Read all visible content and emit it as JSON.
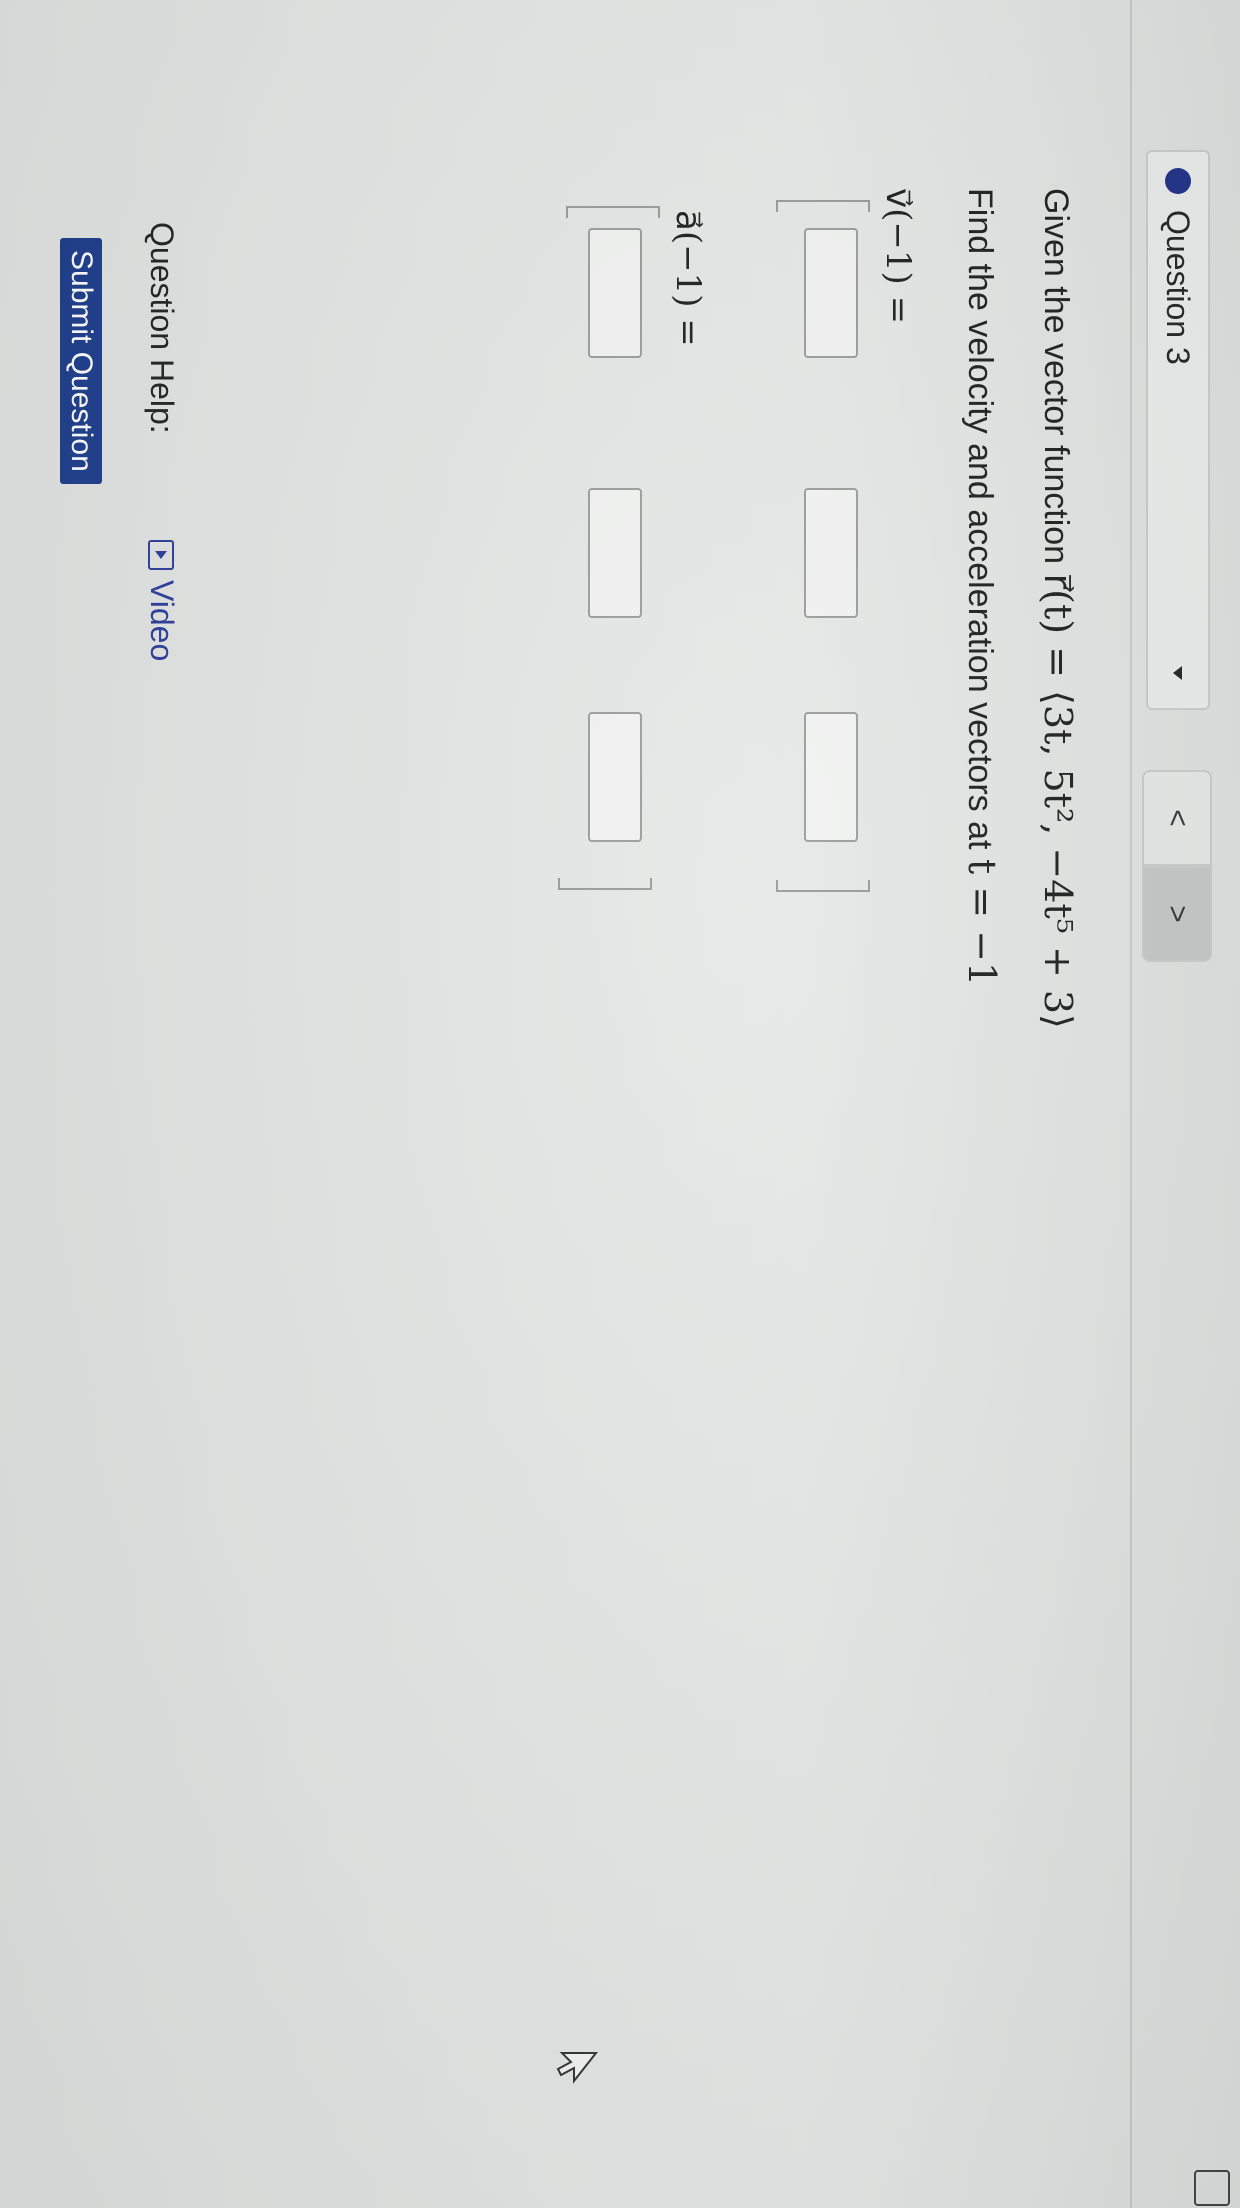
{
  "header": {
    "question_label": "Question 3",
    "prev_label": "<",
    "next_label": ">",
    "accent_color": "#1e2f86"
  },
  "problem": {
    "intro_text": "Given the vector function ",
    "vector_function": "r⃗(t) = ⟨3t, 5t², −4t⁵ + 3⟩",
    "instruction_text": "Find the velocity and acceleration vectors at ",
    "instruction_math": "t = −1"
  },
  "answers": {
    "velocity_label": "v⃗(−1) =",
    "acceleration_label": "a⃗(−1) =",
    "velocity_values": [
      "",
      "",
      ""
    ],
    "acceleration_values": [
      "",
      "",
      ""
    ]
  },
  "help": {
    "label": "Question Help:",
    "video_label": "Video"
  },
  "actions": {
    "submit_label": "Submit Question",
    "submit_color": "#1d3d8c"
  }
}
